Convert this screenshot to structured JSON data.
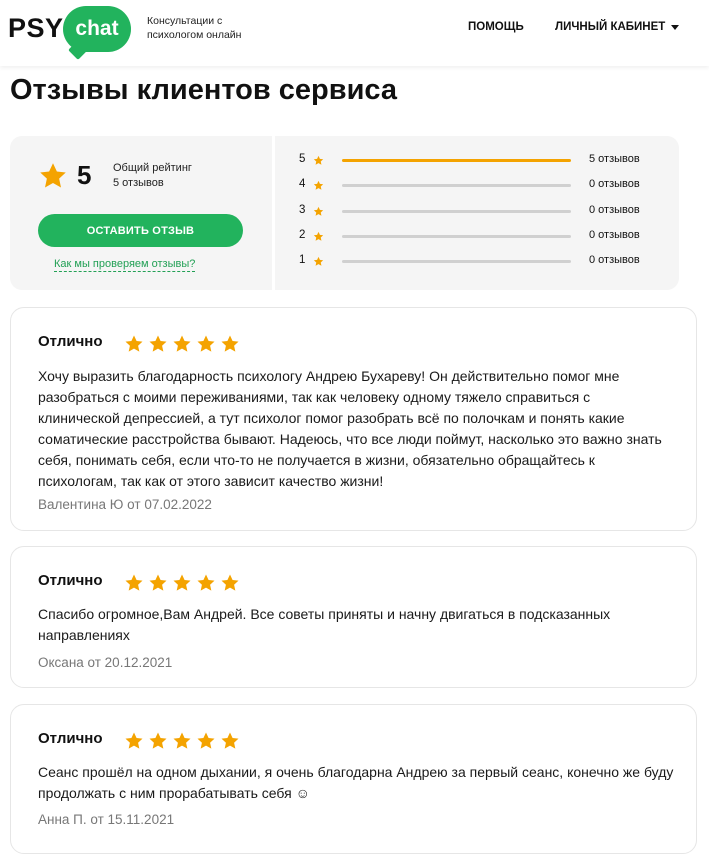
{
  "header": {
    "logo_psy": "PSY",
    "logo_chat": "chat",
    "tagline": "Консультации с психологом онлайн",
    "nav_help": "ПОМОЩЬ",
    "nav_cabinet": "ЛИЧНЫЙ КАБИНЕТ"
  },
  "page_title": "Отзывы клиентов сервиса",
  "summary": {
    "rating": "5",
    "overall_label": "Общий рейтинг",
    "overall_count": "5 отзывов",
    "leave_review_button": "ОСТАВИТЬ ОТЗЫВ",
    "verify_link": "Как мы проверяем отзывы?",
    "breakdown": [
      {
        "stars": "5",
        "count": "5 отзывов",
        "fraction": 1.0
      },
      {
        "stars": "4",
        "count": "0 отзывов",
        "fraction": 0.0
      },
      {
        "stars": "3",
        "count": "0 отзывов",
        "fraction": 0.0
      },
      {
        "stars": "2",
        "count": "0 отзывов",
        "fraction": 0.0
      },
      {
        "stars": "1",
        "count": "0 отзывов",
        "fraction": 0.0
      }
    ]
  },
  "reviews": [
    {
      "title": "Отлично",
      "stars": 5,
      "text": "Хочу выразить благодарность психологу Андрею Бухареву! Он действительно помог мне разобраться с моими переживаниями, так как человеку одному тяжело справиться с клинической депрессией, а тут психолог помог разобрать всё по полочкам и понять какие соматические расстройства бывают. Надеюсь, что все люди поймут, насколько это важно знать себя, понимать себя, если что-то не получается в жизни, обязательно обращайтесь к психологам, так как от этого зависит качество жизни!",
      "meta": "Валентина Ю от 07.02.2022"
    },
    {
      "title": "Отлично",
      "stars": 5,
      "text": "Спасибо огромное,Вам Андрей. Все советы приняты и начну двигаться в подсказанных направлениях",
      "meta": "Оксана от 20.12.2021"
    },
    {
      "title": "Отлично",
      "stars": 5,
      "text": "Сеанс прошёл на одном дыхании, я очень благодарна Андрею за первый сеанс, конечно же буду продолжать с ним прорабатывать себя ☺",
      "meta": "Анна П. от 15.11.2021"
    }
  ],
  "colors": {
    "brand_green": "#22b35d",
    "star_orange": "#f4a300"
  }
}
